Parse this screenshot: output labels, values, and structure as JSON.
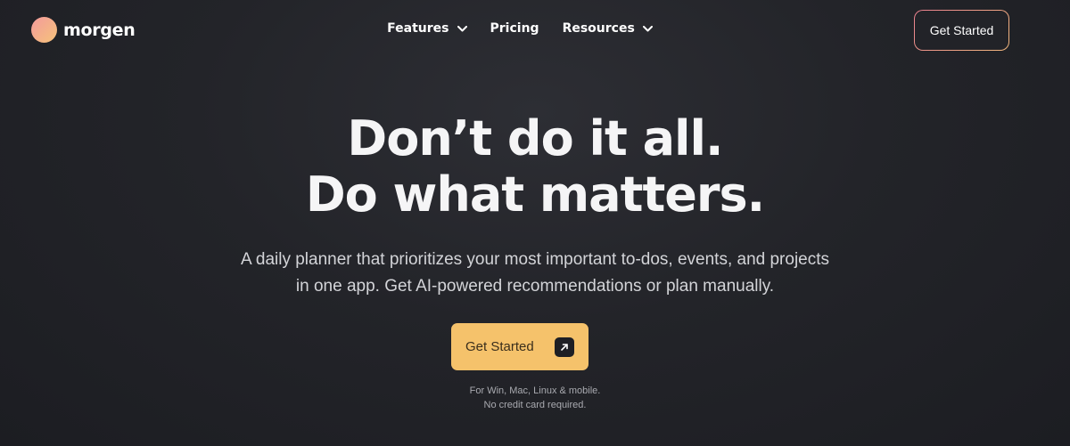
{
  "brand": {
    "name": "morgen",
    "logo_icon": "gradient-circle"
  },
  "nav": {
    "items": [
      {
        "label": "Features",
        "has_dropdown": true
      },
      {
        "label": "Pricing",
        "has_dropdown": false
      },
      {
        "label": "Resources",
        "has_dropdown": true
      }
    ]
  },
  "header": {
    "cta_label": "Get Started"
  },
  "hero": {
    "title_line1": "Don’t do it all.",
    "title_line2": "Do what matters.",
    "subtitle_line1": "A daily planner that prioritizes your most important to-dos, events, and projects",
    "subtitle_line2": "in one app. Get AI-powered recommendations or plan manually.",
    "cta_label": "Get Started",
    "cta_icon": "arrow-up-right-icon",
    "note_line1": "For Win, Mac, Linux & mobile.",
    "note_line2": "No credit card required."
  },
  "colors": {
    "background": "#232429",
    "cta": "#f5c26b",
    "logo_gradient_start": "#f39a9c",
    "logo_gradient_end": "#f6c37a"
  }
}
